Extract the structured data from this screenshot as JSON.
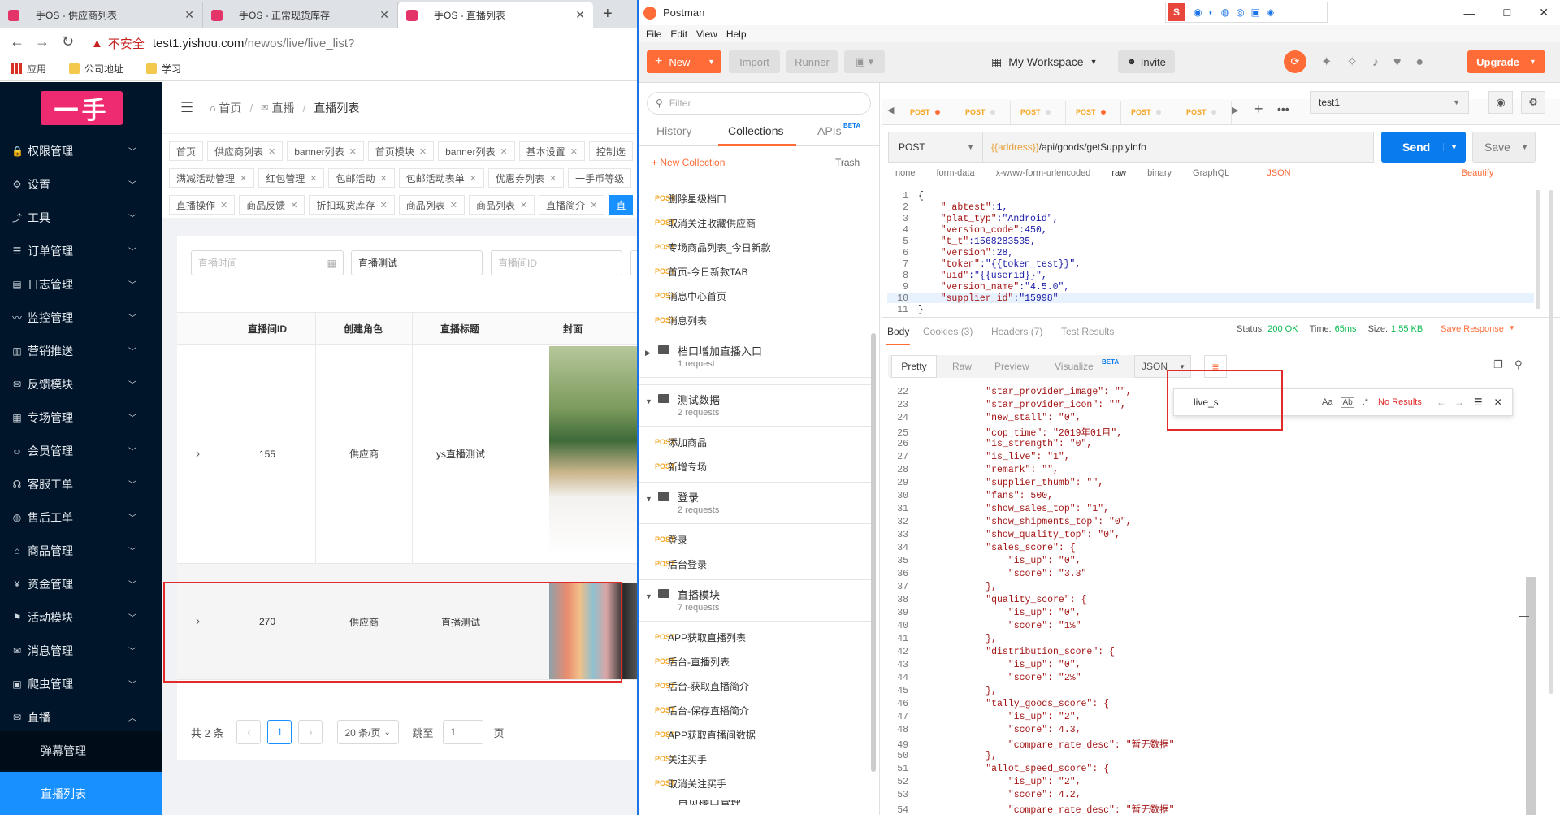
{
  "browser": {
    "tabs": [
      {
        "title": "一手OS - 供应商列表"
      },
      {
        "title": "一手OS - 正常现货库存"
      },
      {
        "title": "一手OS - 直播列表"
      }
    ],
    "new_tab": "+",
    "security_label": "不安全",
    "url_host": "test1.yishou.com",
    "url_path": "/newos/live/live_list?",
    "bookmarks": [
      "应用",
      "公司地址",
      "学习"
    ]
  },
  "admin": {
    "logo_text": "一手",
    "menu": [
      {
        "label": "权限管理"
      },
      {
        "label": "设置"
      },
      {
        "label": "工具"
      },
      {
        "label": "订单管理"
      },
      {
        "label": "日志管理"
      },
      {
        "label": "监控管理"
      },
      {
        "label": "营销推送"
      },
      {
        "label": "反馈模块"
      },
      {
        "label": "专场管理"
      },
      {
        "label": "会员管理"
      },
      {
        "label": "客服工单"
      },
      {
        "label": "售后工单"
      },
      {
        "label": "商品管理"
      },
      {
        "label": "资金管理"
      },
      {
        "label": "活动模块"
      },
      {
        "label": "消息管理"
      },
      {
        "label": "爬虫管理"
      },
      {
        "label": "直播"
      }
    ],
    "submenu": [
      {
        "label": "弹幕管理"
      },
      {
        "label": "直播列表"
      }
    ],
    "breadcrumb": {
      "home": "首页",
      "mid": "直播",
      "current": "直播列表"
    },
    "tag_rows": [
      [
        "首页",
        "供应商列表",
        "banner列表",
        "首页模块",
        "banner列表",
        "基本设置",
        "控制选"
      ],
      [
        "满减活动管理",
        "红包管理",
        "包邮活动",
        "包邮活动表单",
        "优惠券列表",
        "一手币等级"
      ],
      [
        "直播操作",
        "商品反馈",
        "折扣现货库存",
        "商品列表",
        "商品列表",
        "直播简介",
        "直"
      ]
    ],
    "filters": {
      "time_placeholder": "直播时间",
      "title_value": "直播测试",
      "id_placeholder": "直播间ID"
    },
    "table": {
      "columns": [
        "直播间ID",
        "创建角色",
        "直播标题",
        "封面"
      ],
      "rows": [
        {
          "expand": "›",
          "id": "155",
          "role": "供应商",
          "title": "ys直播测试"
        },
        {
          "expand": "›",
          "id": "270",
          "role": "供应商",
          "title": "直播测试"
        }
      ]
    },
    "pager": {
      "total": "共 2 条",
      "prev": "‹",
      "page": "1",
      "next": "›",
      "page_size": "20 条/页",
      "goto_label": "跳至",
      "goto_value": "1",
      "page_unit": "页"
    }
  },
  "postman": {
    "app_title": "Postman",
    "menu": [
      "File",
      "Edit",
      "View",
      "Help"
    ],
    "toolbar": {
      "new": "New",
      "import": "Import",
      "runner": "Runner",
      "workspace": "My Workspace",
      "invite": "Invite",
      "upgrade": "Upgrade"
    },
    "sidebar": {
      "filter_placeholder": "Filter",
      "tabs": [
        "History",
        "Collections",
        "APIs"
      ],
      "apis_badge": "BETA",
      "new_collection": "+ New Collection",
      "trash": "Trash",
      "method": "POST",
      "top_requests": [
        "删除星级档口",
        "取消关注收藏供应商",
        "专场商品列表_今日新款",
        "首页-今日新款TAB",
        "消息中心首页",
        "消息列表"
      ],
      "folders": [
        {
          "name": "档口增加直播入口",
          "count": "1 request",
          "requests": []
        },
        {
          "name": "测试数据",
          "count": "2 requests",
          "requests": [
            "添加商品",
            "新增专场"
          ]
        },
        {
          "name": "登录",
          "count": "2 requests",
          "requests": [
            "登录",
            "后台登录"
          ]
        },
        {
          "name": "直播模块",
          "count": "7 requests",
          "requests": [
            "APP获取直播列表",
            "后台-直播列表",
            "后台-获取直播简介",
            "后台-保存直播简介",
            "APP获取直播间数据",
            "关注买手",
            "取消关注买手"
          ]
        }
      ],
      "last_folder_partial": "首页接口管理"
    },
    "request_tabs": [
      "POST",
      "POST",
      "POST",
      "POST",
      "POST",
      "POST"
    ],
    "environment": "test1",
    "request": {
      "method": "POST",
      "url_var": "{{address}}",
      "url_path": "/api/goods/getSupplyInfo",
      "send": "Send",
      "save": "Save"
    },
    "body_options": [
      "none",
      "form-data",
      "x-www-form-urlencoded",
      "raw",
      "binary",
      "GraphQL",
      "JSON",
      "Beautify"
    ],
    "request_body": [
      {
        "n": "1",
        "t": "{"
      },
      {
        "n": "2",
        "k": "\"_abtest\"",
        "v": ":1,"
      },
      {
        "n": "3",
        "k": "\"plat_typ\"",
        "v": ":\"Android\","
      },
      {
        "n": "4",
        "k": "\"version_code\"",
        "v": ":450,"
      },
      {
        "n": "5",
        "k": "\"t_t\"",
        "v": ":1568283535,"
      },
      {
        "n": "6",
        "k": "\"version\"",
        "v": ":28,"
      },
      {
        "n": "7",
        "k": "\"token\"",
        "v": ":\"{{token_test}}\","
      },
      {
        "n": "8",
        "k": "\"uid\"",
        "v": ":\"{{userid}}\","
      },
      {
        "n": "9",
        "k": "\"version_name\"",
        "v": ":\"4.5.0\","
      },
      {
        "n": "10",
        "k": "\"supplier_id\"",
        "v": ":\"15998\""
      },
      {
        "n": "11",
        "t": "}"
      }
    ],
    "response_tabs": {
      "body": "Body",
      "cookies": "Cookies (3)",
      "headers": "Headers (7)",
      "tests": "Test Results"
    },
    "status": {
      "status_label": "Status:",
      "status_value": "200 OK",
      "time_label": "Time:",
      "time_value": "65ms",
      "size_label": "Size:",
      "size_value": "1.55 KB",
      "save_response": "Save Response"
    },
    "view_tabs": [
      "Pretty",
      "Raw",
      "Preview",
      "Visualize",
      "JSON"
    ],
    "visualize_badge": "BETA",
    "find": {
      "value": "live_s",
      "result": "No Results"
    },
    "response_lines": [
      {
        "n": "22",
        "t": "        \"star_provider_image\": \"\","
      },
      {
        "n": "23",
        "t": "        \"star_provider_icon\": \"\","
      },
      {
        "n": "24",
        "t": "        \"new_stall\": \"0\","
      },
      {
        "n": "25",
        "t": "        \"cop_time\": \"2019年01月\","
      },
      {
        "n": "26",
        "t": "        \"is_strength\": \"0\","
      },
      {
        "n": "27",
        "t": "        \"is_live\": \"1\","
      },
      {
        "n": "28",
        "t": "        \"remark\": \"\","
      },
      {
        "n": "29",
        "t": "        \"supplier_thumb\": \"\","
      },
      {
        "n": "30",
        "t": "        \"fans\": 500,"
      },
      {
        "n": "31",
        "t": "        \"show_sales_top\": \"1\","
      },
      {
        "n": "32",
        "t": "        \"show_shipments_top\": \"0\","
      },
      {
        "n": "33",
        "t": "        \"show_quality_top\": \"0\","
      },
      {
        "n": "34",
        "t": "        \"sales_score\": {"
      },
      {
        "n": "35",
        "t": "            \"is_up\": \"0\","
      },
      {
        "n": "36",
        "t": "            \"score\": \"3.3\""
      },
      {
        "n": "37",
        "t": "        },"
      },
      {
        "n": "38",
        "t": "        \"quality_score\": {"
      },
      {
        "n": "39",
        "t": "            \"is_up\": \"0\","
      },
      {
        "n": "40",
        "t": "            \"score\": \"1%\""
      },
      {
        "n": "41",
        "t": "        },"
      },
      {
        "n": "42",
        "t": "        \"distribution_score\": {"
      },
      {
        "n": "43",
        "t": "            \"is_up\": \"0\","
      },
      {
        "n": "44",
        "t": "            \"score\": \"2%\""
      },
      {
        "n": "45",
        "t": "        },"
      },
      {
        "n": "46",
        "t": "        \"tally_goods_score\": {"
      },
      {
        "n": "47",
        "t": "            \"is_up\": \"2\","
      },
      {
        "n": "48",
        "t": "            \"score\": 4.3,"
      },
      {
        "n": "49",
        "t": "            \"compare_rate_desc\": \"暂无数据\""
      },
      {
        "n": "50",
        "t": "        },"
      },
      {
        "n": "51",
        "t": "        \"allot_speed_score\": {"
      },
      {
        "n": "52",
        "t": "            \"is_up\": \"2\","
      },
      {
        "n": "53",
        "t": "            \"score\": 4.2,"
      },
      {
        "n": "54",
        "t": "            \"compare_rate_desc\": \"暂无数据\""
      }
    ],
    "colors": {
      "orange": "#ff6c37",
      "blue": "#097bed",
      "post": "#f5a623",
      "status_ok": "#0cbb52"
    }
  }
}
